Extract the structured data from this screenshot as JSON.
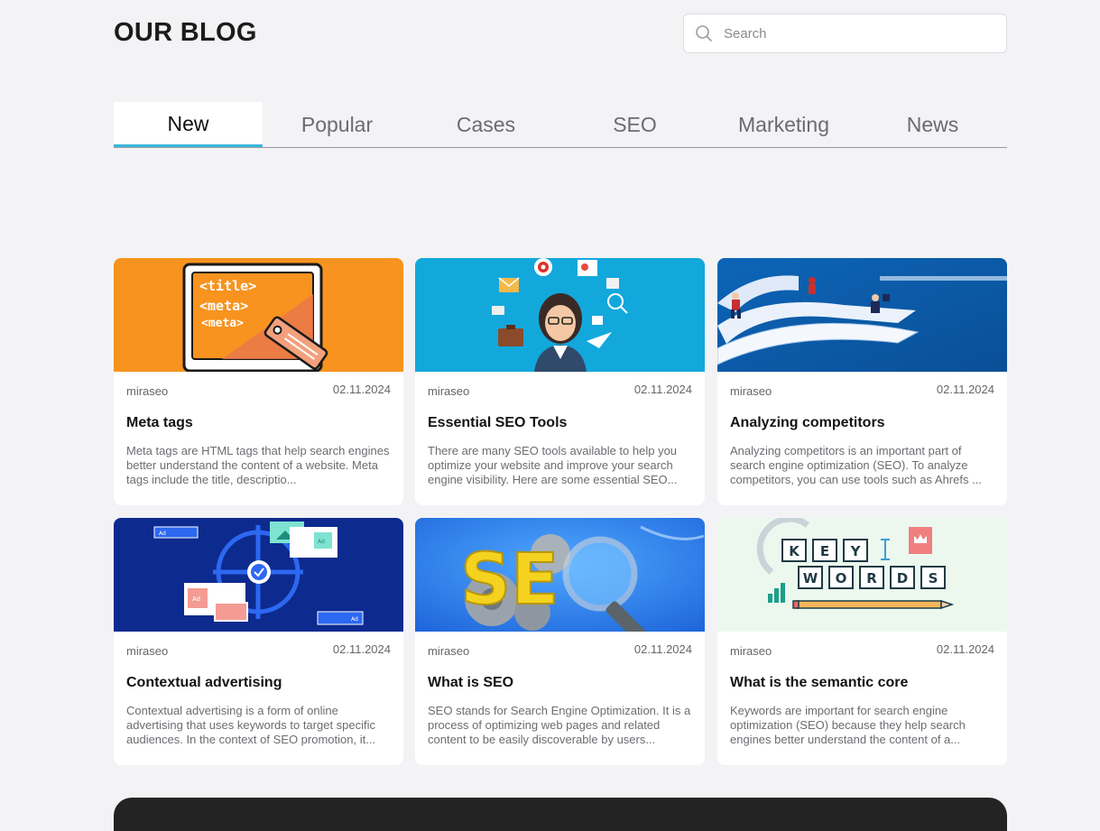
{
  "header": {
    "title": "OUR BLOG",
    "search_placeholder": "Search"
  },
  "tabs": [
    {
      "label": "New",
      "active": true
    },
    {
      "label": "Popular",
      "active": false
    },
    {
      "label": "Cases",
      "active": false
    },
    {
      "label": "SEO",
      "active": false
    },
    {
      "label": "Marketing",
      "active": false
    },
    {
      "label": "News",
      "active": false
    }
  ],
  "cards": [
    {
      "author": "miraseo",
      "date": "02.11.2024",
      "title": "Meta tags",
      "excerpt": "Meta tags are HTML tags that help search engines better understand the content of a website. Meta tags include the title, descriptio...",
      "image_icon": "meta-tags-illustration",
      "image_text": [
        "<title>",
        "<meta>",
        "<meta>"
      ]
    },
    {
      "author": "miraseo",
      "date": "02.11.2024",
      "title": "Essential SEO Tools",
      "excerpt": "There are many SEO tools available to help you optimize your website and improve your search engine visibility. Here are some essential SEO...",
      "image_icon": "seo-tools-illustration"
    },
    {
      "author": "miraseo",
      "date": "02.11.2024",
      "title": "Analyzing competitors",
      "excerpt": "Analyzing competitors is an important part of search engine optimization (SEO). To analyze competitors, you can use tools such as Ahrefs ...",
      "image_icon": "competitors-race-illustration"
    },
    {
      "author": "miraseo",
      "date": "02.11.2024",
      "title": "Contextual advertising",
      "excerpt": "Contextual advertising is a form of online advertising that uses keywords to target specific audiences. In the context of SEO promotion, it...",
      "image_icon": "contextual-ads-illustration",
      "image_text": [
        "Ad",
        "Ad",
        "Ad",
        "Ad"
      ]
    },
    {
      "author": "miraseo",
      "date": "02.11.2024",
      "title": "What is SEO",
      "excerpt": "SEO stands for Search Engine Optimization. It is a process of optimizing web pages and related content to be easily discoverable by users...",
      "image_icon": "seo-magnifier-illustration",
      "image_text": [
        "SE"
      ]
    },
    {
      "author": "miraseo",
      "date": "02.11.2024",
      "title": "What is the semantic core",
      "excerpt": "Keywords are important for search engine optimization (SEO) because they help search engines better understand the content of a...",
      "image_icon": "keywords-illustration",
      "image_text": [
        "K",
        "E",
        "Y",
        "W",
        "O",
        "R",
        "D",
        "S"
      ]
    }
  ],
  "colors": {
    "accent": "#3bb7dd",
    "page_bg": "#f3f3f6",
    "footer_bg": "#232323"
  }
}
